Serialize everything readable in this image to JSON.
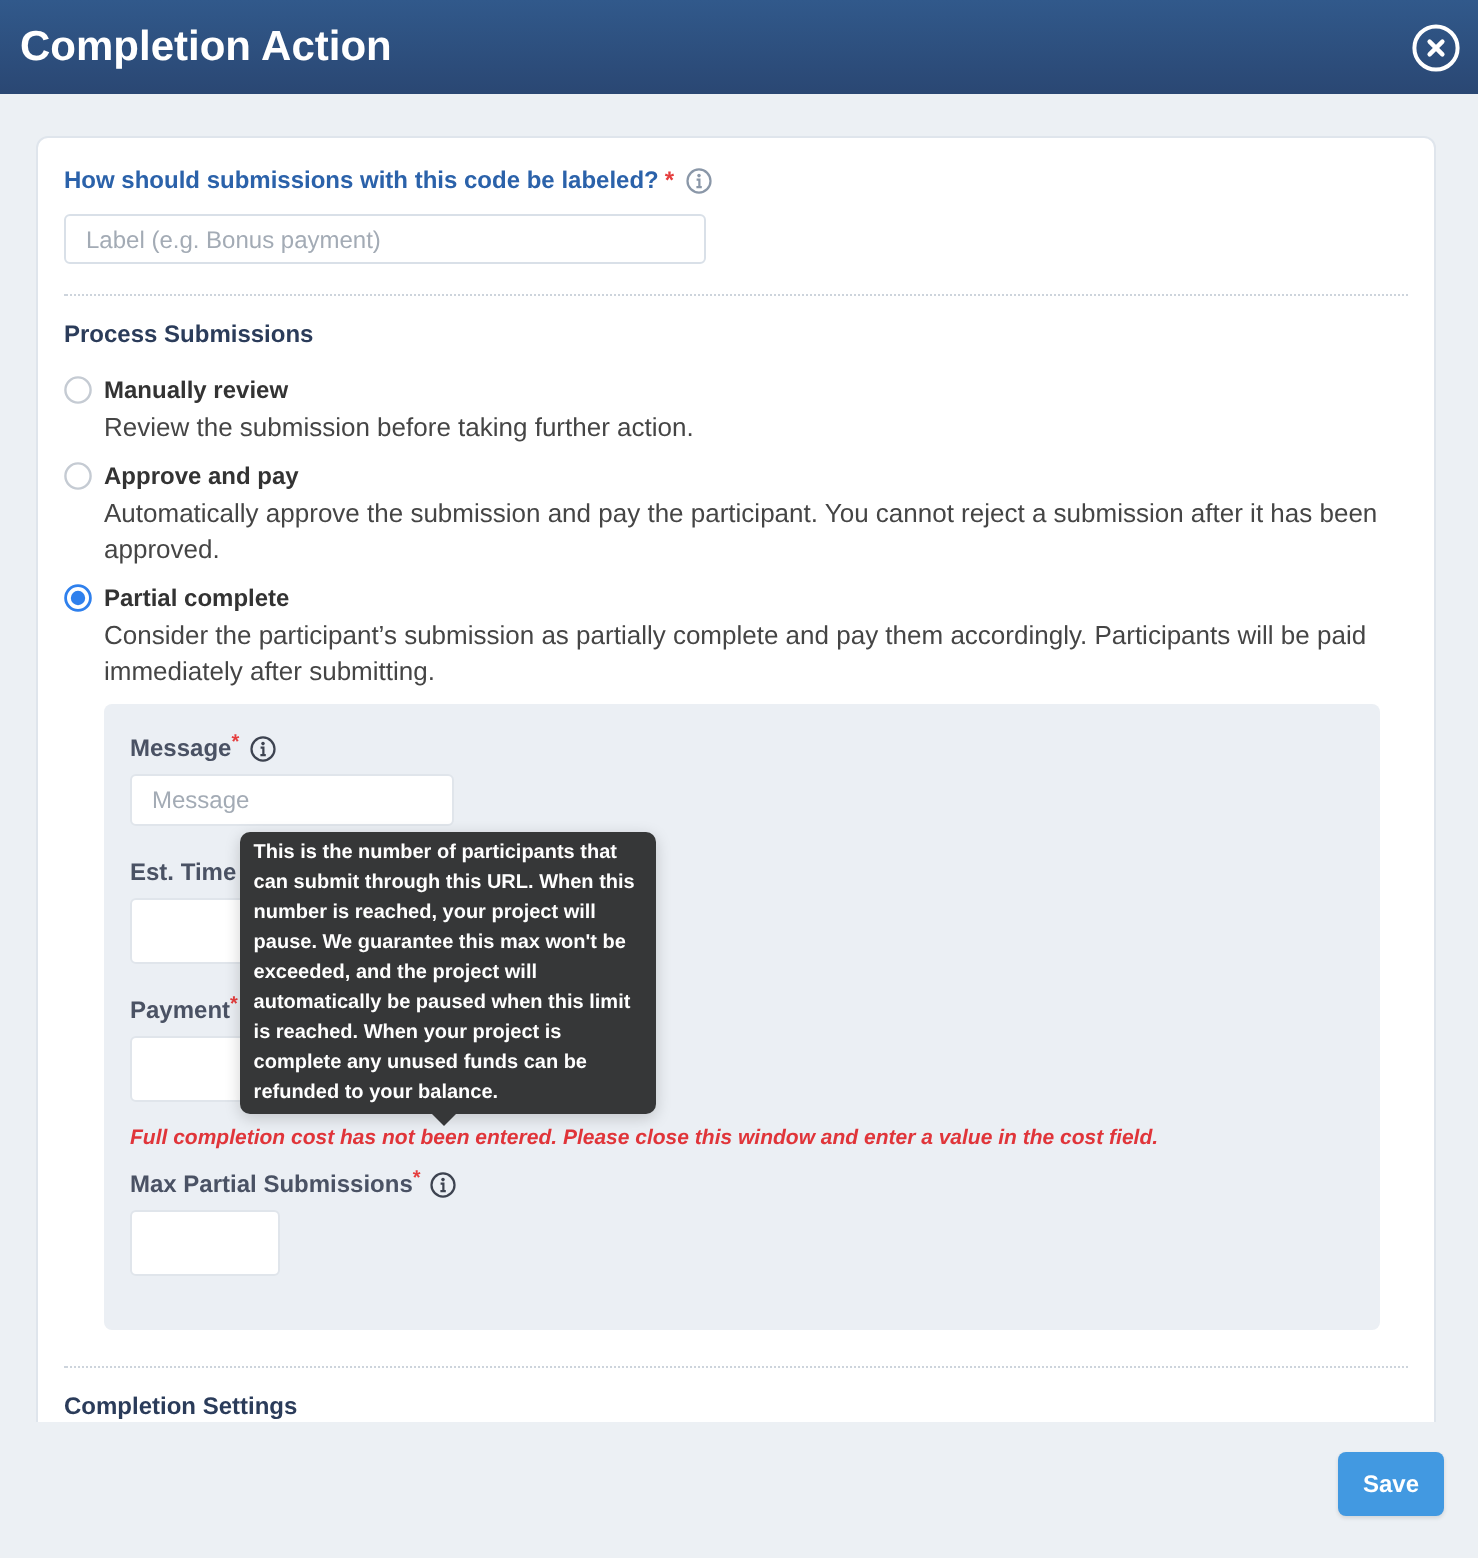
{
  "window": {
    "title": "Completion Action"
  },
  "label_field": {
    "label": "How should submissions with this code be labeled?",
    "required_mark": "*",
    "info": true,
    "placeholder": "Label (e.g. Bonus payment)"
  },
  "process_submissions": {
    "heading": "Process Submissions",
    "options": [
      {
        "title": "Manually review",
        "description": "Review the submission before taking further action.",
        "selected": false
      },
      {
        "title": "Approve and pay",
        "description": "Automatically approve the submission and pay the participant. You cannot reject a submission after it has been approved.",
        "selected": false
      },
      {
        "title": "Partial complete",
        "description": "Consider the participant’s submission as partially complete and pay them accordingly. Participants will be paid immediately after submitting.",
        "selected": true
      }
    ]
  },
  "partial_settings": {
    "items": [
      {
        "kind": "text_input",
        "label": "Message",
        "required_mark": "*",
        "info": true,
        "placeholder": "Message"
      },
      {
        "kind": "number_input",
        "label": "Est. Time"
      },
      {
        "kind": "number_input",
        "label": "Payment",
        "required_mark": "*"
      },
      {
        "kind": "error",
        "text": "Full completion cost has not been entered. Please close this window and enter a value in the cost field."
      },
      {
        "kind": "number_input",
        "label": "Max Partial Submissions",
        "required_mark": "*",
        "info": true,
        "tooltip": "This is the number of participants that can submit through this URL. When this number is reached, your project will pause. We guarantee this max won't be exceeded, and the project will automatically be paused when this limit is reached. When your project is complete any unused funds can be refunded to your balance."
      }
    ]
  },
  "completion_settings": {
    "heading": "Completion Settings"
  },
  "footer": {
    "buttons": [
      "Save"
    ]
  }
}
